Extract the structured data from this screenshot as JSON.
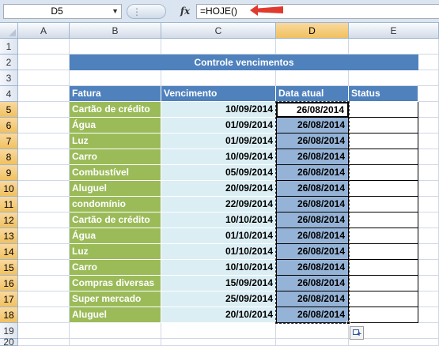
{
  "formula_bar": {
    "name_box": "D5",
    "fx_label": "fx",
    "formula": "=HOJE()"
  },
  "columns": [
    "A",
    "B",
    "C",
    "D",
    "E"
  ],
  "rows": [
    "1",
    "2",
    "3",
    "4",
    "5",
    "6",
    "7",
    "8",
    "9",
    "10",
    "11",
    "12",
    "13",
    "14",
    "15",
    "16",
    "17",
    "18",
    "19",
    "20"
  ],
  "sheet": {
    "title": "Controle vencimentos",
    "headers": {
      "fatura": "Fatura",
      "vencimento": "Vencimento",
      "data_atual": "Data atual",
      "status": "Status"
    },
    "records": [
      {
        "fatura": "Cartão de crédito",
        "vencimento": "10/09/2014",
        "data_atual": "26/08/2014"
      },
      {
        "fatura": "Água",
        "vencimento": "01/09/2014",
        "data_atual": "26/08/2014"
      },
      {
        "fatura": "Luz",
        "vencimento": "01/09/2014",
        "data_atual": "26/08/2014"
      },
      {
        "fatura": "Carro",
        "vencimento": "10/09/2014",
        "data_atual": "26/08/2014"
      },
      {
        "fatura": "Combustível",
        "vencimento": "05/09/2014",
        "data_atual": "26/08/2014"
      },
      {
        "fatura": "Aluguel",
        "vencimento": "20/09/2014",
        "data_atual": "26/08/2014"
      },
      {
        "fatura": "condomínio",
        "vencimento": "22/09/2014",
        "data_atual": "26/08/2014"
      },
      {
        "fatura": "Cartão de crédito",
        "vencimento": "10/10/2014",
        "data_atual": "26/08/2014"
      },
      {
        "fatura": "Água",
        "vencimento": "01/10/2014",
        "data_atual": "26/08/2014"
      },
      {
        "fatura": "Luz",
        "vencimento": "01/10/2014",
        "data_atual": "26/08/2014"
      },
      {
        "fatura": "Carro",
        "vencimento": "10/10/2014",
        "data_atual": "26/08/2014"
      },
      {
        "fatura": "Compras diversas",
        "vencimento": "15/09/2014",
        "data_atual": "26/08/2014"
      },
      {
        "fatura": "Super mercado",
        "vencimento": "25/09/2014",
        "data_atual": "26/08/2014"
      },
      {
        "fatura": "Aluguel",
        "vencimento": "20/10/2014",
        "data_atual": "26/08/2014"
      }
    ]
  },
  "colors": {
    "header_blue": "#4f81bd",
    "fatura_green": "#9bbb59",
    "vencimento_fill": "#dbeef3",
    "data_atual_fill": "#95b3d7",
    "arrow_red": "#e03a2f"
  },
  "icons": [
    "name-box-dropdown-icon",
    "fx-icon",
    "red-arrow-icon",
    "autofill-options-icon"
  ]
}
